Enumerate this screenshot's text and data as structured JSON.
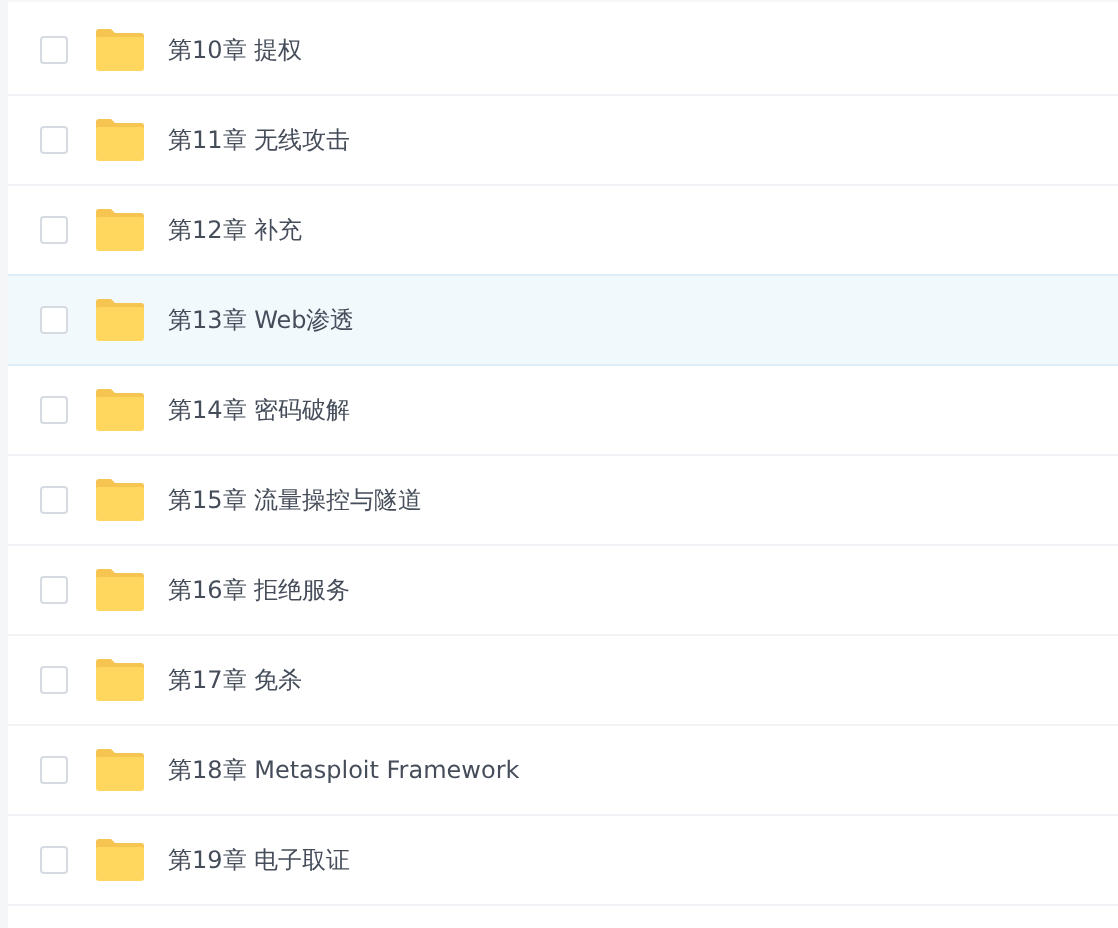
{
  "files": [
    {
      "name": "第10章 提权",
      "checked": false,
      "highlighted": false
    },
    {
      "name": "第11章 无线攻击",
      "checked": false,
      "highlighted": false
    },
    {
      "name": "第12章 补充",
      "checked": false,
      "highlighted": false
    },
    {
      "name": "第13章 Web渗透",
      "checked": false,
      "highlighted": true
    },
    {
      "name": "第14章 密码破解",
      "checked": false,
      "highlighted": false
    },
    {
      "name": "第15章 流量操控与隧道",
      "checked": false,
      "highlighted": false
    },
    {
      "name": "第16章 拒绝服务",
      "checked": false,
      "highlighted": false
    },
    {
      "name": "第17章 免杀",
      "checked": false,
      "highlighted": false
    },
    {
      "name": "第18章 Metasploit Framework",
      "checked": false,
      "highlighted": false
    },
    {
      "name": "第19章 电子取证",
      "checked": false,
      "highlighted": false
    }
  ]
}
